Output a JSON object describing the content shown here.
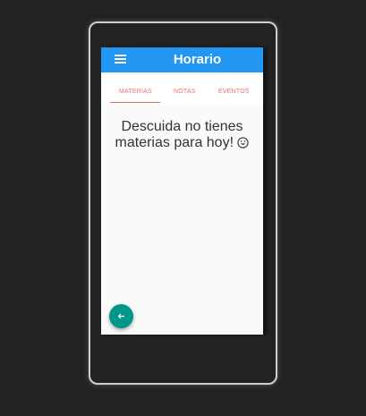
{
  "appbar": {
    "title": "Horario",
    "menu_icon": "hamburger-menu-icon",
    "color": "#2196f3"
  },
  "tabs": [
    {
      "label": "MATERIAS",
      "active": true
    },
    {
      "label": "NOTAS",
      "active": false
    },
    {
      "label": "EVENTOS",
      "active": false
    }
  ],
  "tab_accent_color": "#e57373",
  "content": {
    "empty_line1": "Descuida no tienes",
    "empty_line2": "materias para hoy!",
    "emoji_icon": "smiley-face-icon"
  },
  "fab": {
    "icon": "arrow-left-icon",
    "color": "#009688"
  }
}
